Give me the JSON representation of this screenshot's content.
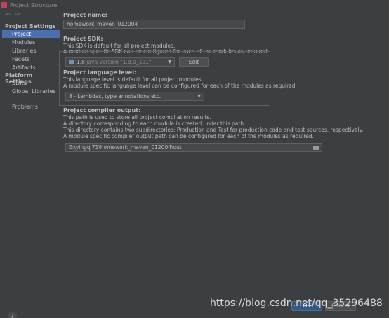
{
  "window": {
    "title": "Project Structure"
  },
  "nav": {
    "back": "←",
    "forward": "→"
  },
  "sidebar": {
    "project_settings_header": "Project Settings",
    "project_items": [
      "Project",
      "Modules",
      "Libraries",
      "Facets",
      "Artifacts"
    ],
    "platform_settings_header": "Platform Settings",
    "platform_items": [
      "SDKs",
      "Global Libraries"
    ],
    "problems": "Problems",
    "selected": "Project"
  },
  "help": "?",
  "project_name": {
    "label": "Project name:",
    "value": "homework_maven_012004"
  },
  "project_sdk": {
    "label": "Project SDK:",
    "desc1": "This SDK is default for all project modules.",
    "desc2": "A module specific SDK can be configured for each of the modules as required.",
    "selected_version": "1.8",
    "selected_detail": "java version \"1.8.0_191\"",
    "edit_button": "Edit"
  },
  "language_level": {
    "label": "Project language level:",
    "desc1": "This language level is default for all project modules.",
    "desc2": "A module specific language level can be configured for each of the modules as required.",
    "selected": "8 - Lambdas, type annotations etc."
  },
  "compiler_output": {
    "label": "Project compiler output:",
    "desc1": "This path is used to store all project compilation results.",
    "desc2": "A directory corresponding to each module is created under this path.",
    "desc3": "This directory contains two subdirectories: Production and Test for production code and test sources, respectively.",
    "desc4": "A module specific compiler output path can be configured for each of the modules as required.",
    "path": "E:\\yingqi71\\homework_maven_012004\\out"
  },
  "dialog_buttons": {
    "ok": "OK",
    "cancel": "Cancel"
  },
  "watermark": "https://blog.csdn.net/qq_35296488",
  "colors": {
    "selection": "#4b6eaf",
    "highlight_box": "#e8242c",
    "background": "#3c3f41"
  }
}
